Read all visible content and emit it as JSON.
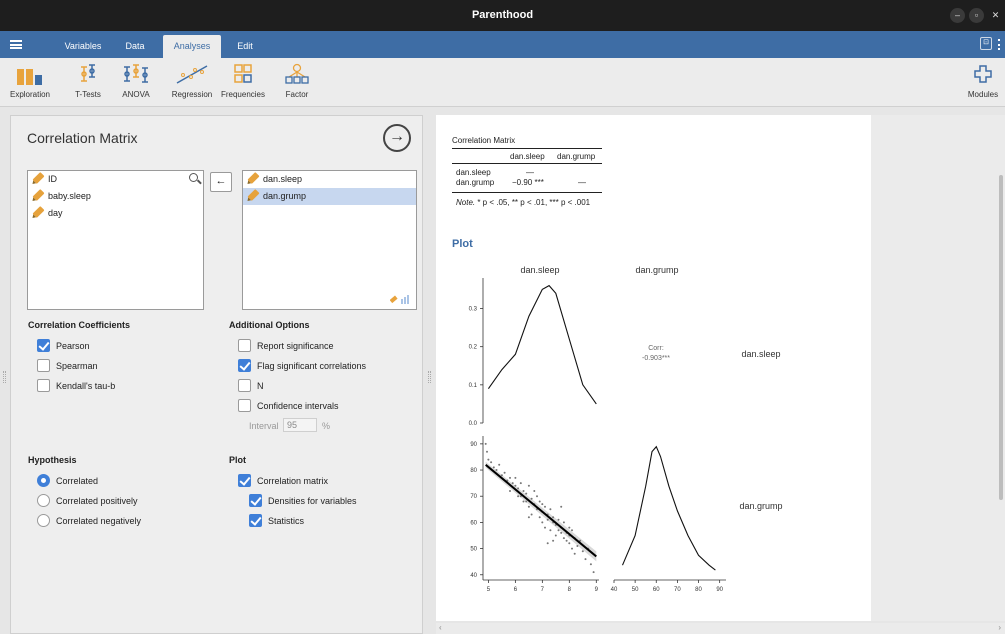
{
  "window": {
    "title": "Parenthood"
  },
  "tabs": [
    {
      "label": "Variables"
    },
    {
      "label": "Data"
    },
    {
      "label": "Analyses"
    },
    {
      "label": "Edit"
    }
  ],
  "toolbar": {
    "items": [
      {
        "label": "Exploration",
        "icon": "exploration-icon"
      },
      {
        "label": "T-Tests",
        "icon": "t-tests-icon"
      },
      {
        "label": "ANOVA",
        "icon": "anova-icon"
      },
      {
        "label": "Regression",
        "icon": "regression-icon"
      },
      {
        "label": "Frequencies",
        "icon": "frequencies-icon"
      },
      {
        "label": "Factor",
        "icon": "factor-icon"
      }
    ],
    "modules_label": "Modules"
  },
  "analysis": {
    "title": "Correlation Matrix",
    "source_variables": [
      "ID",
      "baby.sleep",
      "day"
    ],
    "selected_variables": [
      "dan.sleep",
      "dan.grump"
    ],
    "correlation_coefficients": {
      "title": "Correlation Coefficients",
      "options": [
        {
          "label": "Pearson",
          "checked": true
        },
        {
          "label": "Spearman",
          "checked": false
        },
        {
          "label": "Kendall's tau-b",
          "checked": false
        }
      ]
    },
    "additional_options": {
      "title": "Additional Options",
      "options": [
        {
          "label": "Report significance",
          "checked": false
        },
        {
          "label": "Flag significant correlations",
          "checked": true
        },
        {
          "label": "N",
          "checked": false
        },
        {
          "label": "Confidence intervals",
          "checked": false
        }
      ],
      "interval_label": "Interval",
      "interval_value": "95",
      "interval_unit": "%"
    },
    "hypothesis": {
      "title": "Hypothesis",
      "options": [
        {
          "label": "Correlated",
          "selected": true
        },
        {
          "label": "Correlated positively",
          "selected": false
        },
        {
          "label": "Correlated negatively",
          "selected": false
        }
      ]
    },
    "plot": {
      "title": "Plot",
      "options": [
        {
          "label": "Correlation matrix",
          "checked": true
        },
        {
          "label": "Densities for variables",
          "checked": true
        },
        {
          "label": "Statistics",
          "checked": true
        }
      ]
    }
  },
  "results": {
    "table_title": "Correlation Matrix",
    "columns": [
      "",
      "dan.sleep",
      "dan.grump"
    ],
    "rows": [
      [
        "dan.sleep",
        "—",
        ""
      ],
      [
        "dan.grump",
        "−0.90 ***",
        "—"
      ]
    ],
    "note_label": "Note.",
    "note_text": " * p < .05, ** p < .01, *** p < .001",
    "plot_heading": "Plot"
  },
  "chart_data": {
    "type": "scatter",
    "col_labels": [
      "dan.sleep",
      "dan.grump"
    ],
    "row_labels": [
      "dan.sleep",
      "dan.grump"
    ],
    "corr_label": "Corr:",
    "corr_value": "-0.903***",
    "density_sleep": {
      "x": [
        5,
        5.5,
        6,
        6.5,
        7,
        7.25,
        7.5,
        8,
        8.5,
        9
      ],
      "y": [
        0.09,
        0.14,
        0.18,
        0.28,
        0.35,
        0.36,
        0.34,
        0.22,
        0.1,
        0.05
      ],
      "xlim": [
        4.8,
        9.1
      ],
      "yticks": [
        "0.0",
        "0.1",
        "0.2",
        "0.3"
      ],
      "ylim": [
        0,
        0.38
      ]
    },
    "density_grump": {
      "x": [
        44,
        50,
        55,
        58,
        60,
        62,
        66,
        70,
        75,
        80,
        85,
        88
      ],
      "y": [
        0.003,
        0.009,
        0.019,
        0.026,
        0.027,
        0.025,
        0.019,
        0.014,
        0.009,
        0.005,
        0.003,
        0.002
      ],
      "xticks": [
        "40",
        "50",
        "60",
        "70",
        "80",
        "90"
      ],
      "xlim": [
        40,
        93
      ]
    },
    "scatter": {
      "xticks": [
        "5",
        "6",
        "7",
        "8",
        "9"
      ],
      "yticks": [
        "40",
        "50",
        "60",
        "70",
        "80",
        "90"
      ],
      "xlim": [
        4.8,
        9.1
      ],
      "ylim": [
        38,
        93
      ],
      "regression": {
        "x": [
          4.9,
          9.0
        ],
        "y": [
          82,
          47
        ]
      },
      "points": [
        [
          4.9,
          90
        ],
        [
          4.95,
          87
        ],
        [
          5.0,
          84
        ],
        [
          5.1,
          83
        ],
        [
          5.2,
          81
        ],
        [
          5.3,
          80
        ],
        [
          5.4,
          82
        ],
        [
          5.5,
          78
        ],
        [
          5.6,
          79
        ],
        [
          5.7,
          76
        ],
        [
          5.8,
          77
        ],
        [
          5.9,
          75
        ],
        [
          6.0,
          74
        ],
        [
          6.0,
          77
        ],
        [
          6.1,
          73
        ],
        [
          6.2,
          70
        ],
        [
          6.2,
          75
        ],
        [
          6.3,
          72
        ],
        [
          6.4,
          71
        ],
        [
          6.4,
          68
        ],
        [
          6.5,
          74
        ],
        [
          6.5,
          66
        ],
        [
          6.6,
          69
        ],
        [
          6.6,
          63
        ],
        [
          6.7,
          72
        ],
        [
          6.7,
          67
        ],
        [
          6.8,
          65
        ],
        [
          6.8,
          70
        ],
        [
          6.9,
          62
        ],
        [
          6.9,
          68
        ],
        [
          7.0,
          64
        ],
        [
          7.0,
          60
        ],
        [
          7.1,
          66
        ],
        [
          7.1,
          58
        ],
        [
          7.2,
          63
        ],
        [
          7.2,
          61
        ],
        [
          7.3,
          65
        ],
        [
          7.3,
          57
        ],
        [
          7.4,
          60
        ],
        [
          7.4,
          62
        ],
        [
          7.5,
          59
        ],
        [
          7.5,
          55
        ],
        [
          7.6,
          61
        ],
        [
          7.6,
          57
        ],
        [
          7.7,
          56
        ],
        [
          7.7,
          58
        ],
        [
          7.8,
          54
        ],
        [
          7.8,
          60
        ],
        [
          7.9,
          53
        ],
        [
          7.9,
          56
        ],
        [
          8.0,
          55
        ],
        [
          8.0,
          52
        ],
        [
          8.1,
          57
        ],
        [
          8.1,
          50
        ],
        [
          8.2,
          54
        ],
        [
          8.2,
          48
        ],
        [
          8.3,
          51
        ],
        [
          8.4,
          53
        ],
        [
          8.5,
          49
        ],
        [
          8.6,
          46
        ],
        [
          8.7,
          50
        ],
        [
          8.8,
          44
        ],
        [
          8.9,
          41
        ],
        [
          6.3,
          68
        ],
        [
          6.1,
          70
        ],
        [
          5.8,
          72
        ],
        [
          7.0,
          67
        ],
        [
          7.2,
          52
        ],
        [
          6.5,
          62
        ],
        [
          7.7,
          66
        ],
        [
          8.0,
          58
        ],
        [
          7.4,
          53
        ]
      ]
    }
  }
}
